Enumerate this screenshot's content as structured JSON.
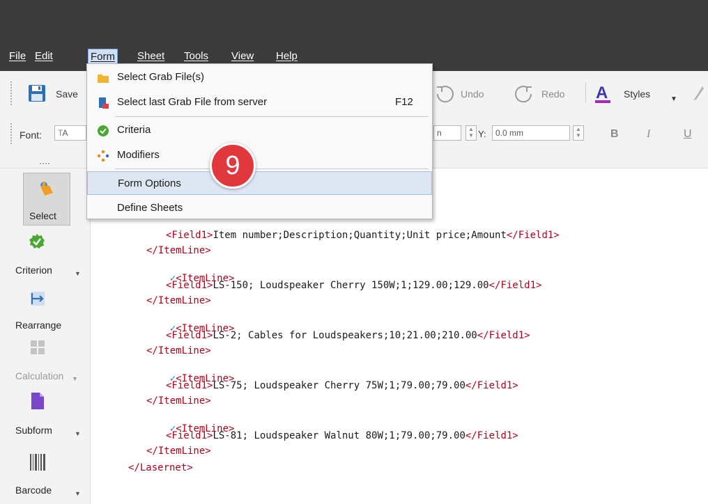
{
  "menubar": {
    "items": [
      {
        "label": "File"
      },
      {
        "label": "Edit"
      },
      {
        "label": "Form"
      },
      {
        "label": "Sheet"
      },
      {
        "label": "Tools"
      },
      {
        "label": "View"
      },
      {
        "label": "Help"
      }
    ]
  },
  "toolbar": {
    "save_label": "Save",
    "undo_label": "Undo",
    "redo_label": "Redo",
    "styles_label": "Styles",
    "font_label": "Font:",
    "font_value": "A",
    "x_value_suffix": "n",
    "y_label": "Y:",
    "y_value": "0.0 mm",
    "bold_label": "B",
    "italic_label": "I",
    "underline_label": "U"
  },
  "form_menu": {
    "items": [
      {
        "label": "Select Grab File(s)",
        "shortcut": ""
      },
      {
        "label": "Select last Grab File from server",
        "shortcut": "F12"
      },
      {
        "label": "Criteria",
        "shortcut": ""
      },
      {
        "label": "Modifiers",
        "shortcut": ""
      },
      {
        "label": "Form Options",
        "shortcut": ""
      },
      {
        "label": "Define Sheets",
        "shortcut": ""
      }
    ]
  },
  "step_badge": "9",
  "tools": [
    {
      "label": "Select"
    },
    {
      "label": "Criterion"
    },
    {
      "label": "Rearrange"
    },
    {
      "label": "Calculation"
    },
    {
      "label": "Subform"
    },
    {
      "label": "Barcode"
    }
  ],
  "editor": {
    "lines": [
      "<Field1>Item number;Description;Quantity;Unit price;Amount</Field1>",
      "</ItemLine>",
      "<ItemLine>",
      "<Field1>LS-150; Loudspeaker Cherry 150W;1;129.00;129.00</Field1>",
      "</ItemLine>",
      "<ItemLine>",
      "<Field1>LS-2; Cables for Loudspeakers;10;21.00;210.00</Field1>",
      "</ItemLine>",
      "<ItemLine>",
      "<Field1>LS-75; Loudspeaker Cherry 75W;1;79.00;79.00</Field1>",
      "</ItemLine>",
      "<ItemLine>",
      "<Field1>LS-81; Loudspeaker Walnut 80W;1;79.00;79.00</Field1>",
      "</ItemLine>",
      "</Lasernet>"
    ]
  }
}
